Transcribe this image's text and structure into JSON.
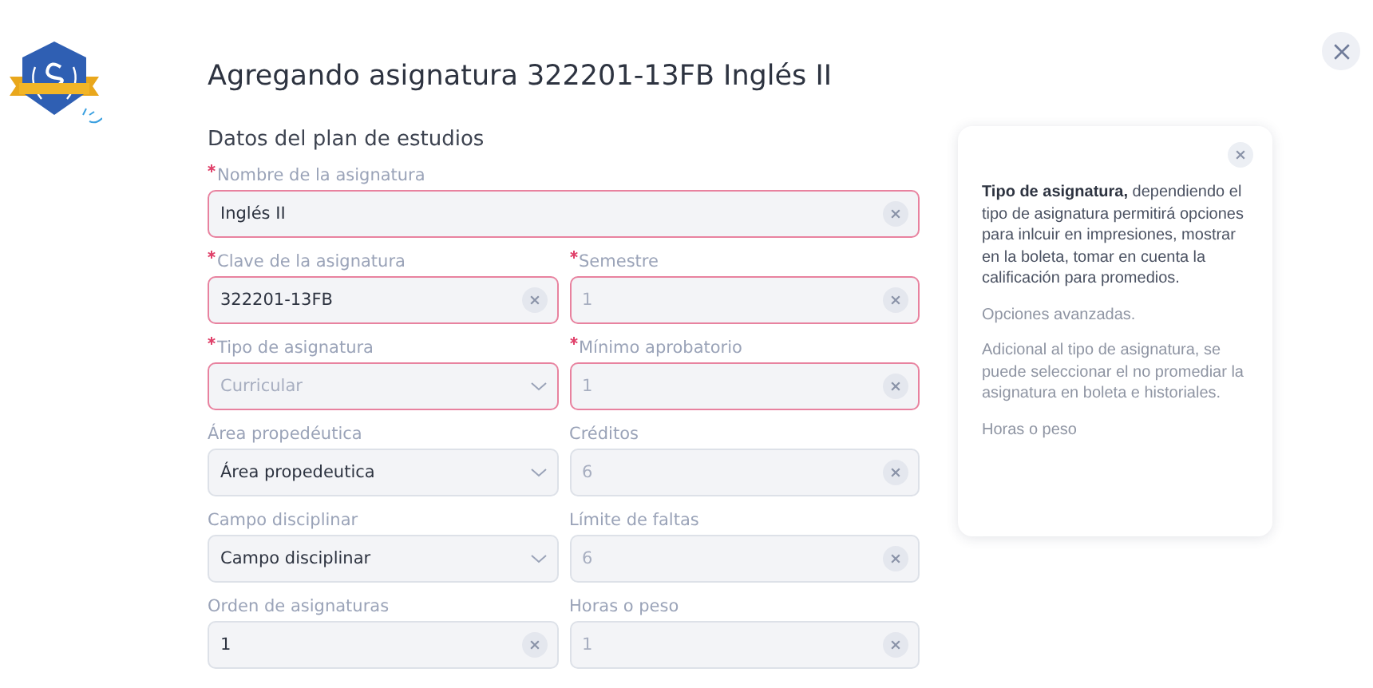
{
  "title": "Agregando asignatura 322201-13FB Inglés II",
  "section": "Datos del plan de estudios",
  "rows": [
    [
      {
        "label": "Nombre de la asignatura",
        "required": true,
        "kind": "text",
        "value": "Inglés II",
        "disabled": false
      }
    ],
    [
      {
        "label": "Clave de la asignatura",
        "required": true,
        "kind": "text",
        "value": "322201-13FB",
        "disabled": false
      },
      {
        "label": "Semestre",
        "required": true,
        "kind": "text",
        "value": "1",
        "disabled": true
      }
    ],
    [
      {
        "label": "Tipo de asignatura",
        "required": true,
        "kind": "select",
        "value": "Curricular",
        "disabled": true
      },
      {
        "label": "Mínimo aprobatorio",
        "required": true,
        "kind": "text",
        "value": "1",
        "disabled": true
      }
    ],
    [
      {
        "label": "Área propedéutica",
        "required": false,
        "kind": "select",
        "value": "Área propedeutica",
        "disabled": false
      },
      {
        "label": "Créditos",
        "required": false,
        "kind": "text",
        "value": "6",
        "disabled": true
      }
    ],
    [
      {
        "label": "Campo disciplinar",
        "required": false,
        "kind": "select",
        "value": "Campo disciplinar",
        "disabled": false
      },
      {
        "label": "Límite de faltas",
        "required": false,
        "kind": "text",
        "value": "6",
        "disabled": true
      }
    ],
    [
      {
        "label": "Orden de asignaturas",
        "required": false,
        "kind": "text",
        "value": "1",
        "disabled": false
      },
      {
        "label": "Horas o peso",
        "required": false,
        "kind": "text",
        "value": "1",
        "disabled": true
      }
    ]
  ],
  "help": {
    "paragraphs": [
      "**Tipo de asignatura,** dependiendo el tipo de asignatura permitirá opciones para inlcuir en impresiones, mostrar en la boleta, tomar en cuenta la calificación para promedios.",
      "Opciones avanzadas.",
      "Adicional al tipo de asignatura, se puede seleccionar el no promediar la asignatura en boleta e historiales.",
      "Horas o peso"
    ]
  }
}
